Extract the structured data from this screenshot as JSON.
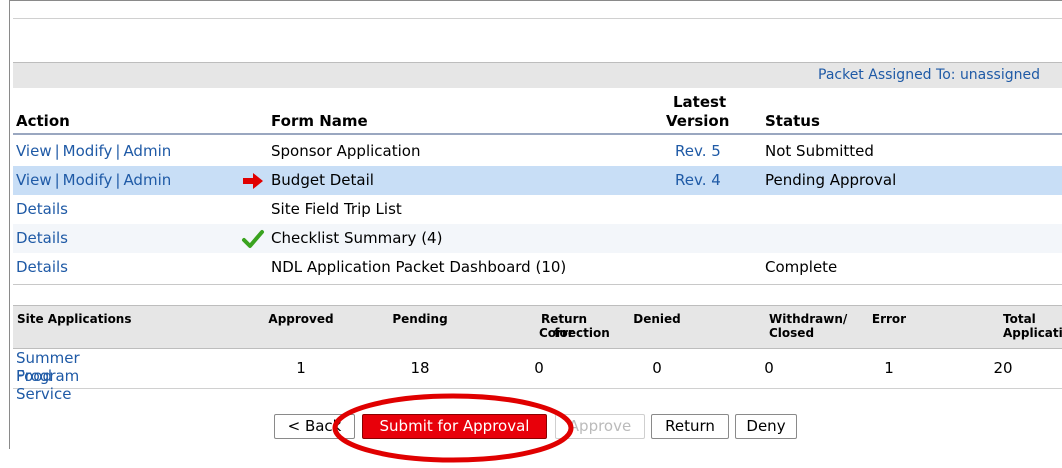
{
  "assigned": {
    "label": "Packet Assigned To:",
    "value": "unassigned"
  },
  "forms_table": {
    "headers": {
      "action": "Action",
      "form_name": "Form Name",
      "latest": "Latest",
      "version": "Version",
      "status": "Status"
    },
    "rows": [
      {
        "links": [
          "View",
          "Modify",
          "Admin"
        ],
        "icon": "",
        "form": "Sponsor Application",
        "version": "Rev. 5",
        "status": "Not Submitted"
      },
      {
        "links": [
          "View",
          "Modify",
          "Admin"
        ],
        "icon": "red-arrow-icon",
        "form": "Budget Detail",
        "version": "Rev. 4",
        "status": "Pending Approval"
      },
      {
        "links": [
          "Details"
        ],
        "icon": "",
        "form": "Site Field Trip List",
        "version": "",
        "status": ""
      },
      {
        "links": [
          "Details"
        ],
        "icon": "green-checkmark-icon",
        "form": "Checklist Summary (4)",
        "version": "",
        "status": ""
      },
      {
        "links": [
          "Details"
        ],
        "icon": "",
        "form": "NDL Application Packet Dashboard (10)",
        "version": "",
        "status": "Complete"
      }
    ]
  },
  "site_table": {
    "headers": {
      "site": "Site Applications",
      "approved": "Approved",
      "pending": "Pending",
      "return1": "Return for",
      "return2": "Correction",
      "denied": "Denied",
      "withdrawn1": "Withdrawn/",
      "withdrawn2": "Closed",
      "error": "Error",
      "total1": "Total",
      "total2": "Applications"
    },
    "row": {
      "name1": "Summer Food Service",
      "name2": "Program",
      "approved": "1",
      "pending": "18",
      "return": "0",
      "denied": "0",
      "withdrawn": "0",
      "error": "1",
      "total": "20"
    }
  },
  "buttons": {
    "back": "< Back",
    "submit": "Submit for Approval",
    "approve": "Approve",
    "return": "Return",
    "deny": "Deny"
  },
  "colors": {
    "link": "#1f5aa6",
    "selected_row": "#c8def6",
    "submit_button": "#e8000a",
    "annotation_circle": "#e00000"
  }
}
